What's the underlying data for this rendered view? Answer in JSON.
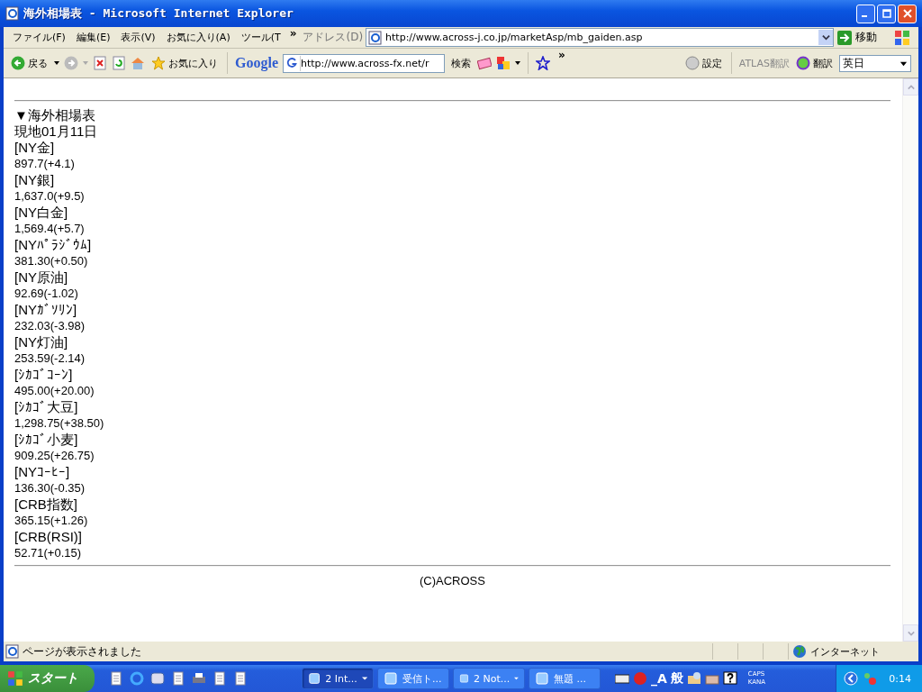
{
  "window": {
    "title": "海外相場表 - Microsoft Internet Explorer"
  },
  "menu_bar": {
    "items": [
      "ファイル(F)",
      "編集(E)",
      "表示(V)",
      "お気に入り(A)",
      "ツール(T"
    ],
    "more": "»"
  },
  "address_bar": {
    "label": "アドレス(D)",
    "url": "http://www.across-j.co.jp/marketAsp/mb_gaiden.asp",
    "go_button": "移動"
  },
  "toolbar": {
    "back": "戻る",
    "favorites": "お気に入り",
    "google_logo": "Google",
    "google_url": "http://www.across-fx.net/r",
    "search": "検索",
    "more": "»",
    "settings": "設定",
    "atlas": "ATLAS翻訳",
    "translate": "翻訳",
    "language": "英日"
  },
  "page": {
    "heading": "▼海外相場表",
    "date": "現地01月11日",
    "quotes": [
      {
        "name": "[NY金]",
        "value": "897.7(+4.1)"
      },
      {
        "name": "[NY銀]",
        "value": "1,637.0(+9.5)"
      },
      {
        "name": "[NY白金]",
        "value": "1,569.4(+5.7)"
      },
      {
        "name": "[NYﾊﾟﾗｼﾞｳﾑ]",
        "value": "381.30(+0.50)"
      },
      {
        "name": "[NY原油]",
        "value": "92.69(-1.02)"
      },
      {
        "name": "[NYｶﾞｿﾘﾝ]",
        "value": "232.03(-3.98)"
      },
      {
        "name": "[NY灯油]",
        "value": "253.59(-2.14)"
      },
      {
        "name": "[ｼｶｺﾞｺｰﾝ]",
        "value": "495.00(+20.00)"
      },
      {
        "name": "[ｼｶｺﾞ大豆]",
        "value": "1,298.75(+38.50)"
      },
      {
        "name": "[ｼｶｺﾞ小麦]",
        "value": "909.25(+26.75)"
      },
      {
        "name": "[NYｺｰﾋｰ]",
        "value": "136.30(-0.35)"
      },
      {
        "name": "[CRB指数]",
        "value": "365.15(+1.26)"
      },
      {
        "name": "[CRB(RSI)]",
        "value": "52.71(+0.15)"
      }
    ],
    "footer": "(C)ACROSS"
  },
  "status_bar": {
    "text": "ページが表示されました",
    "zone": "インターネット"
  },
  "taskbar": {
    "start": "スタート",
    "tasks": [
      {
        "label": "2 Int...",
        "selected": true,
        "grouped": true
      },
      {
        "label": "受信ト...",
        "selected": false,
        "grouped": false
      },
      {
        "label": "2 Not...",
        "selected": false,
        "grouped": true
      },
      {
        "label": "無題 ...",
        "selected": false,
        "grouped": false
      }
    ],
    "ime_mode": "_A",
    "ime_kana": "般",
    "caps": "CAPS",
    "kana": "KANA",
    "time": "0:14"
  }
}
